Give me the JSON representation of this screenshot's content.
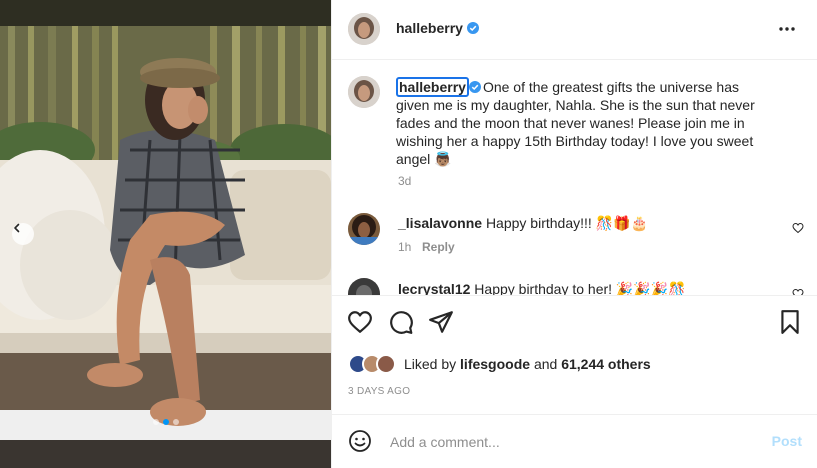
{
  "post": {
    "username": "halleberry",
    "verified": true,
    "more_icon": "more-horizontal-icon",
    "caption": {
      "username": "halleberry",
      "text": "One of the greatest gifts the universe has given me is my daughter, Nahla. She is the sun that never fades and the moon that never wanes! Please join me in wishing her a happy 15th Birthday today! I love you sweet angel 👼🏽",
      "time": "3d"
    },
    "comments": [
      {
        "username": "_lisalavonne",
        "text": "Happy birthday!!! 🎊🎁🎂",
        "time": "1h",
        "reply_label": "Reply"
      },
      {
        "username": "lecrystal12",
        "text": "Happy birthday to her! 🎉🎉🎉🎊"
      }
    ],
    "likes": {
      "prefix": "Liked by",
      "first_user": "lifesgoode",
      "connector": "and",
      "others": "61,244 others"
    },
    "time_ago": "3 DAYS AGO",
    "add_comment": {
      "placeholder": "Add a comment...",
      "post_label": "Post"
    },
    "carousel": {
      "slide_count": 3,
      "active_index": 1
    }
  },
  "colors": {
    "accent_blue": "#0095f6",
    "verified_blue": "#3897f0",
    "post_disabled": "#b2dffc",
    "muted_text": "#8e8e8e",
    "focus_outline": "#1a73e8"
  }
}
